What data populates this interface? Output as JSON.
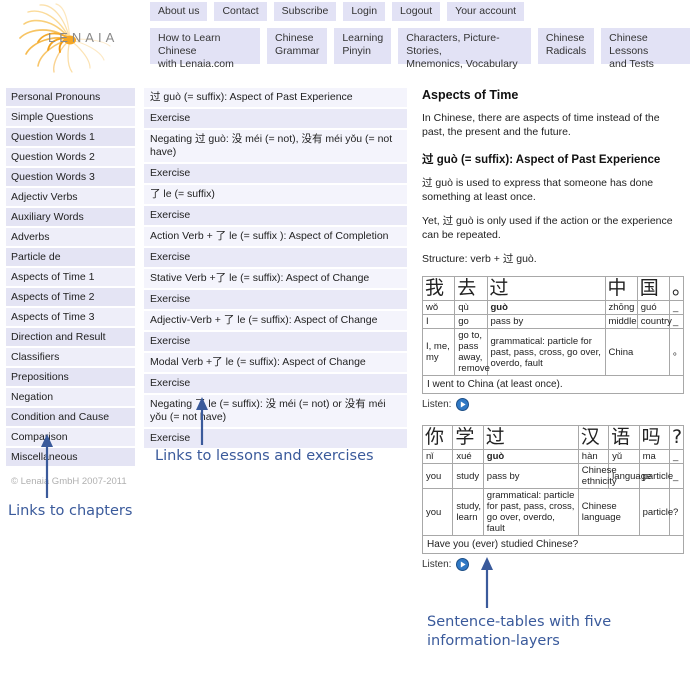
{
  "header": {
    "logo_text": "LENAIA",
    "logo_icon": "spiral-swirl-logo",
    "nav_top": [
      {
        "label": "About us"
      },
      {
        "label": "Contact"
      },
      {
        "label": "Subscribe"
      },
      {
        "label": "Login"
      },
      {
        "label": "Logout"
      },
      {
        "label": "Your account"
      }
    ],
    "nav_main": [
      {
        "label": "How to Learn Chinese\nwith Lenaia.com"
      },
      {
        "label": "Chinese\nGrammar"
      },
      {
        "label": "Learning\nPinyin"
      },
      {
        "label": "Characters, Picture-Stories,\nMnemonics, Vocabulary"
      },
      {
        "label": "Chinese\nRadicals"
      },
      {
        "label": "Chinese Lessons\nand Tests"
      }
    ]
  },
  "sidebar": {
    "items": [
      {
        "label": "Personal Pronouns"
      },
      {
        "label": "Simple Questions"
      },
      {
        "label": "Question Words 1"
      },
      {
        "label": "Question Words 2"
      },
      {
        "label": "Question Words 3"
      },
      {
        "label": "Adjectiv Verbs"
      },
      {
        "label": "Auxiliary Words"
      },
      {
        "label": "Adverbs"
      },
      {
        "label": "Particle de"
      },
      {
        "label": "Aspects of Time 1"
      },
      {
        "label": "Aspects of Time 2"
      },
      {
        "label": "Aspects of Time 3"
      },
      {
        "label": "Direction and Result"
      },
      {
        "label": "Classifiers"
      },
      {
        "label": "Prepositions"
      },
      {
        "label": "Negation"
      },
      {
        "label": "Condition and Cause"
      },
      {
        "label": "Comparison"
      },
      {
        "label": "Miscellaneous"
      }
    ],
    "copyright": "© Lenaia GmbH 2007-2011"
  },
  "lessons": [
    {
      "label": "过 guò (= suffix): Aspect of Past Experience",
      "type": "lesson"
    },
    {
      "label": "Exercise",
      "type": "exercise"
    },
    {
      "label": "Negating 过 guò: 没 méi (= not), 没有 méi yǒu (= not have)",
      "type": "lesson"
    },
    {
      "label": "Exercise",
      "type": "exercise"
    },
    {
      "label": "了 le (= suffix)",
      "type": "lesson"
    },
    {
      "label": "Exercise",
      "type": "exercise"
    },
    {
      "label": "Action Verb + 了 le (= suffix ): Aspect of Completion",
      "type": "lesson"
    },
    {
      "label": "Exercise",
      "type": "exercise"
    },
    {
      "label": "Stative Verb +了 le (= suffix): Aspect of Change",
      "type": "lesson"
    },
    {
      "label": "Exercise",
      "type": "exercise"
    },
    {
      "label": "Adjectiv-Verb + 了 le (= suffix): Aspect of Change",
      "type": "lesson"
    },
    {
      "label": "Exercise",
      "type": "exercise"
    },
    {
      "label": "Modal Verb +了 le (= suffix): Aspect of Change",
      "type": "lesson"
    },
    {
      "label": "Exercise",
      "type": "exercise"
    },
    {
      "label": "Negating 了 le (= suffix): 没 méi (= not) or 没有 méi yǒu (= not have)",
      "type": "lesson"
    },
    {
      "label": "Exercise",
      "type": "exercise"
    }
  ],
  "article": {
    "title": "Aspects of Time",
    "intro": "In Chinese, there are aspects of time instead of the past, the present and the future.",
    "subtitle": "过 guò (= suffix): Aspect of Past Experience",
    "para1": "过 guò is used to express that someone has done something at least once.",
    "para2": "Yet, 过 guò is only used if the action or the experience can be repeated.",
    "structure": "Structure: verb + 过 guò.",
    "listen_label": "Listen:"
  },
  "tables": [
    {
      "hanzi": [
        "我",
        "去",
        "过",
        "中",
        "国",
        "。"
      ],
      "colors": [
        "c-green",
        "c-blue",
        "c-blue",
        "c-red",
        "c-gold",
        "punct"
      ],
      "pinyin": [
        "wǒ",
        "qù",
        "guò",
        "zhōng",
        "guó",
        "_"
      ],
      "key_index": 2,
      "meaning": [
        "I",
        "go",
        "pass by",
        "middle",
        "country",
        "_"
      ],
      "detail": [
        "I, me, my",
        "go to, pass away, remove",
        "grammatical: particle for past, pass, cross, go over, overdo, fault",
        "China",
        "。"
      ],
      "detail_spans": [
        1,
        1,
        1,
        2,
        1
      ],
      "translation": "I went to China (at least once)."
    },
    {
      "hanzi": [
        "你",
        "学",
        "过",
        "汉",
        "语",
        "吗",
        "?"
      ],
      "colors": [
        "c-green",
        "c-gold",
        "c-blue",
        "c-blue",
        "c-green",
        "c-gray",
        "punct"
      ],
      "pinyin": [
        "nǐ",
        "xué",
        "guò",
        "hàn",
        "yǔ",
        "ma",
        "_"
      ],
      "key_index": 2,
      "meaning": [
        "you",
        "study",
        "pass by",
        "Chinese ethnicity",
        "language",
        "particle",
        "_"
      ],
      "detail": [
        "you",
        "study, learn",
        "grammatical: particle for past, pass, cross, go over, overdo, fault",
        "Chinese language",
        "particle",
        "?"
      ],
      "detail_spans": [
        1,
        1,
        1,
        2,
        1,
        1
      ],
      "translation": "Have you (ever) studied Chinese?"
    }
  ],
  "annotations": {
    "chapters": "Links to chapters",
    "lessons": "Links to lessons and exercises",
    "tables": "Sentence-tables with five\ninformation-layers"
  },
  "colors": {
    "nav_bg": "#e2e2f5",
    "sidebar_bg": "#e4e4f4",
    "annotation": "#3a5a9b",
    "logo": "#f5b921"
  }
}
